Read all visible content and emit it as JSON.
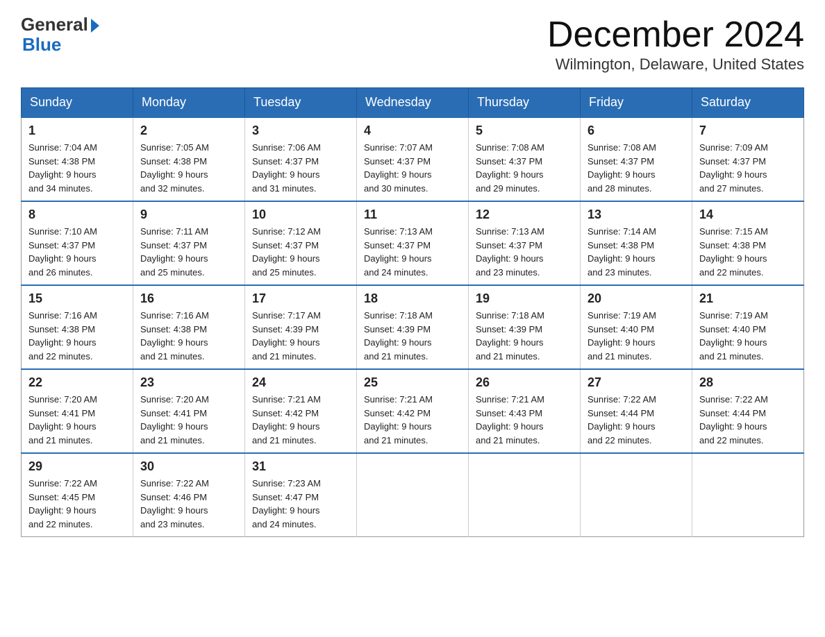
{
  "logo": {
    "general": "General",
    "blue": "Blue"
  },
  "title": "December 2024",
  "location": "Wilmington, Delaware, United States",
  "days_of_week": [
    "Sunday",
    "Monday",
    "Tuesday",
    "Wednesday",
    "Thursday",
    "Friday",
    "Saturday"
  ],
  "weeks": [
    [
      {
        "day": "1",
        "sunrise": "7:04 AM",
        "sunset": "4:38 PM",
        "daylight": "9 hours and 34 minutes."
      },
      {
        "day": "2",
        "sunrise": "7:05 AM",
        "sunset": "4:38 PM",
        "daylight": "9 hours and 32 minutes."
      },
      {
        "day": "3",
        "sunrise": "7:06 AM",
        "sunset": "4:37 PM",
        "daylight": "9 hours and 31 minutes."
      },
      {
        "day": "4",
        "sunrise": "7:07 AM",
        "sunset": "4:37 PM",
        "daylight": "9 hours and 30 minutes."
      },
      {
        "day": "5",
        "sunrise": "7:08 AM",
        "sunset": "4:37 PM",
        "daylight": "9 hours and 29 minutes."
      },
      {
        "day": "6",
        "sunrise": "7:08 AM",
        "sunset": "4:37 PM",
        "daylight": "9 hours and 28 minutes."
      },
      {
        "day": "7",
        "sunrise": "7:09 AM",
        "sunset": "4:37 PM",
        "daylight": "9 hours and 27 minutes."
      }
    ],
    [
      {
        "day": "8",
        "sunrise": "7:10 AM",
        "sunset": "4:37 PM",
        "daylight": "9 hours and 26 minutes."
      },
      {
        "day": "9",
        "sunrise": "7:11 AM",
        "sunset": "4:37 PM",
        "daylight": "9 hours and 25 minutes."
      },
      {
        "day": "10",
        "sunrise": "7:12 AM",
        "sunset": "4:37 PM",
        "daylight": "9 hours and 25 minutes."
      },
      {
        "day": "11",
        "sunrise": "7:13 AM",
        "sunset": "4:37 PM",
        "daylight": "9 hours and 24 minutes."
      },
      {
        "day": "12",
        "sunrise": "7:13 AM",
        "sunset": "4:37 PM",
        "daylight": "9 hours and 23 minutes."
      },
      {
        "day": "13",
        "sunrise": "7:14 AM",
        "sunset": "4:38 PM",
        "daylight": "9 hours and 23 minutes."
      },
      {
        "day": "14",
        "sunrise": "7:15 AM",
        "sunset": "4:38 PM",
        "daylight": "9 hours and 22 minutes."
      }
    ],
    [
      {
        "day": "15",
        "sunrise": "7:16 AM",
        "sunset": "4:38 PM",
        "daylight": "9 hours and 22 minutes."
      },
      {
        "day": "16",
        "sunrise": "7:16 AM",
        "sunset": "4:38 PM",
        "daylight": "9 hours and 21 minutes."
      },
      {
        "day": "17",
        "sunrise": "7:17 AM",
        "sunset": "4:39 PM",
        "daylight": "9 hours and 21 minutes."
      },
      {
        "day": "18",
        "sunrise": "7:18 AM",
        "sunset": "4:39 PM",
        "daylight": "9 hours and 21 minutes."
      },
      {
        "day": "19",
        "sunrise": "7:18 AM",
        "sunset": "4:39 PM",
        "daylight": "9 hours and 21 minutes."
      },
      {
        "day": "20",
        "sunrise": "7:19 AM",
        "sunset": "4:40 PM",
        "daylight": "9 hours and 21 minutes."
      },
      {
        "day": "21",
        "sunrise": "7:19 AM",
        "sunset": "4:40 PM",
        "daylight": "9 hours and 21 minutes."
      }
    ],
    [
      {
        "day": "22",
        "sunrise": "7:20 AM",
        "sunset": "4:41 PM",
        "daylight": "9 hours and 21 minutes."
      },
      {
        "day": "23",
        "sunrise": "7:20 AM",
        "sunset": "4:41 PM",
        "daylight": "9 hours and 21 minutes."
      },
      {
        "day": "24",
        "sunrise": "7:21 AM",
        "sunset": "4:42 PM",
        "daylight": "9 hours and 21 minutes."
      },
      {
        "day": "25",
        "sunrise": "7:21 AM",
        "sunset": "4:42 PM",
        "daylight": "9 hours and 21 minutes."
      },
      {
        "day": "26",
        "sunrise": "7:21 AM",
        "sunset": "4:43 PM",
        "daylight": "9 hours and 21 minutes."
      },
      {
        "day": "27",
        "sunrise": "7:22 AM",
        "sunset": "4:44 PM",
        "daylight": "9 hours and 22 minutes."
      },
      {
        "day": "28",
        "sunrise": "7:22 AM",
        "sunset": "4:44 PM",
        "daylight": "9 hours and 22 minutes."
      }
    ],
    [
      {
        "day": "29",
        "sunrise": "7:22 AM",
        "sunset": "4:45 PM",
        "daylight": "9 hours and 22 minutes."
      },
      {
        "day": "30",
        "sunrise": "7:22 AM",
        "sunset": "4:46 PM",
        "daylight": "9 hours and 23 minutes."
      },
      {
        "day": "31",
        "sunrise": "7:23 AM",
        "sunset": "4:47 PM",
        "daylight": "9 hours and 24 minutes."
      },
      null,
      null,
      null,
      null
    ]
  ],
  "labels": {
    "sunrise": "Sunrise:",
    "sunset": "Sunset:",
    "daylight": "Daylight:"
  }
}
